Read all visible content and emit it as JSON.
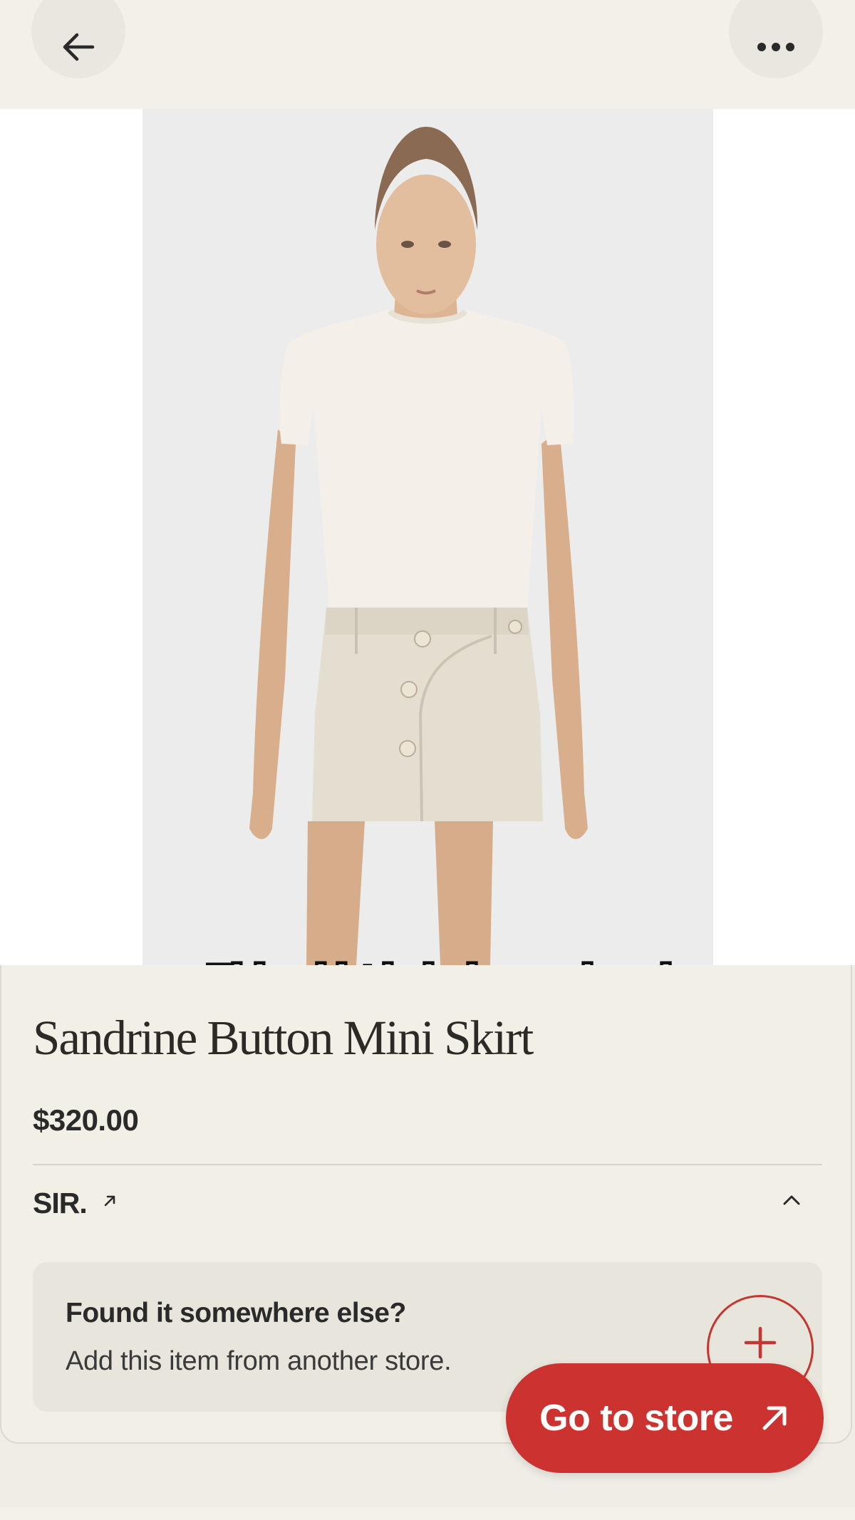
{
  "nav": {
    "back_icon": "arrow-left-icon",
    "more_icon": "more-horizontal-icon"
  },
  "media": {
    "caption": "This skirt is being ordered as we speak"
  },
  "product": {
    "title": "Sandrine Button Mini Skirt",
    "price": "$320.00"
  },
  "brand": {
    "name": "SIR.",
    "link_icon": "external-link-icon",
    "toggle_icon": "chevron-up-icon"
  },
  "found_elsewhere": {
    "title": "Found it somewhere else?",
    "subtitle": "Add this item from another store.",
    "add_icon": "plus-icon"
  },
  "cta": {
    "label": "Go to store",
    "icon": "arrow-up-right-icon"
  },
  "colors": {
    "accent": "#cc3330",
    "background": "#efede6"
  }
}
